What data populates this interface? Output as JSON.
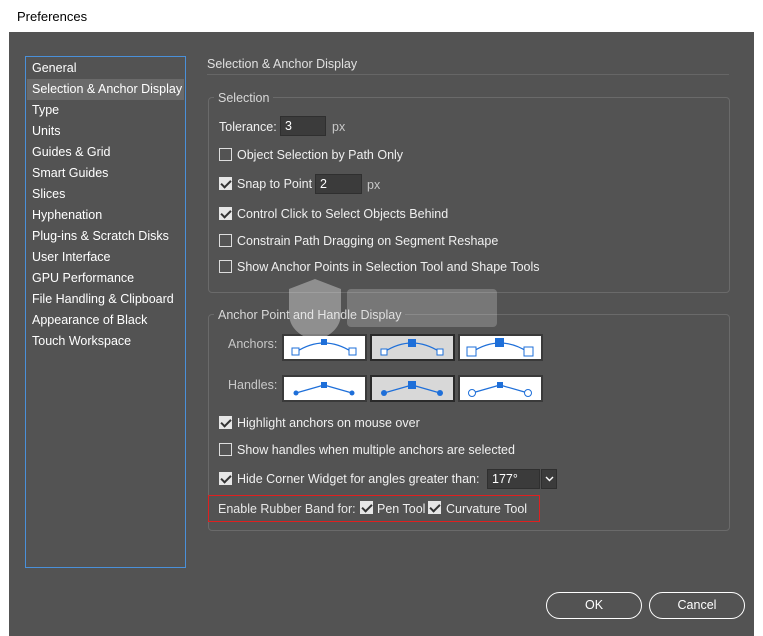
{
  "window": {
    "title": "Preferences"
  },
  "sidebar": {
    "items": [
      {
        "label": "General"
      },
      {
        "label": "Selection & Anchor Display"
      },
      {
        "label": "Type"
      },
      {
        "label": "Units"
      },
      {
        "label": "Guides & Grid"
      },
      {
        "label": "Smart Guides"
      },
      {
        "label": "Slices"
      },
      {
        "label": "Hyphenation"
      },
      {
        "label": "Plug-ins & Scratch Disks"
      },
      {
        "label": "User Interface"
      },
      {
        "label": "GPU Performance"
      },
      {
        "label": "File Handling & Clipboard"
      },
      {
        "label": "Appearance of Black"
      },
      {
        "label": "Touch Workspace"
      }
    ],
    "selected_index": 1
  },
  "main": {
    "section_title": "Selection & Anchor Display",
    "selection": {
      "group_label": "Selection",
      "tolerance_label": "Tolerance:",
      "tolerance_value": "3",
      "tolerance_unit": "px",
      "object_selection_by_path": {
        "label": "Object Selection by Path Only",
        "checked": false
      },
      "snap_to_point": {
        "label": "Snap to Point",
        "checked": true,
        "value": "2",
        "unit": "px"
      },
      "control_click": {
        "label": "Control Click to Select Objects Behind",
        "checked": true
      },
      "constrain_path": {
        "label": "Constrain Path Dragging on Segment Reshape",
        "checked": false
      },
      "show_anchor_points": {
        "label": "Show Anchor Points in Selection Tool and Shape Tools",
        "checked": false
      }
    },
    "anchor": {
      "group_label": "Anchor Point and Handle Display",
      "anchors_label": "Anchors:",
      "anchors_selected": 1,
      "handles_label": "Handles:",
      "handles_selected": 1,
      "highlight_anchors": {
        "label": "Highlight anchors on mouse over",
        "checked": true
      },
      "show_handles_multiple": {
        "label": "Show handles when multiple anchors are selected",
        "checked": false
      },
      "hide_corner_widget": {
        "label": "Hide Corner Widget for angles greater than:",
        "checked": true,
        "value": "177°"
      },
      "rubber_band_label": "Enable Rubber Band for:",
      "pen_tool": {
        "label": "Pen Tool",
        "checked": true
      },
      "curvature_tool": {
        "label": "Curvature Tool",
        "checked": true
      }
    }
  },
  "footer": {
    "ok_label": "OK",
    "cancel_label": "Cancel"
  },
  "colors": {
    "panel_bg": "#535353",
    "accent_border": "#4a90d9",
    "highlight_border": "#e02020",
    "anchor_blue": "#1e6fd9"
  }
}
